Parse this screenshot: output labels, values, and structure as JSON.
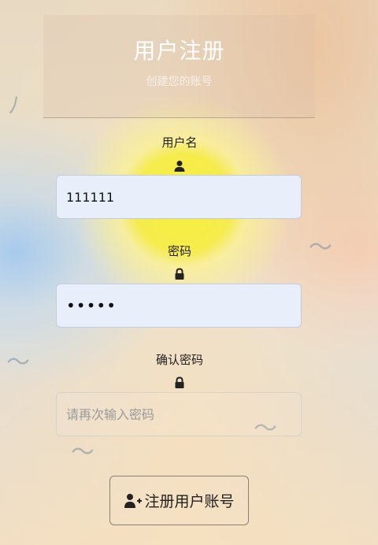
{
  "header": {
    "title": "用户注册",
    "subtitle": "创建您的账号"
  },
  "fields": {
    "username": {
      "label": "用户名",
      "icon": "user-icon",
      "value": "111111",
      "placeholder": ""
    },
    "password": {
      "label": "密码",
      "icon": "lock-icon",
      "value": "•••••",
      "placeholder": ""
    },
    "confirm_password": {
      "label": "确认密码",
      "icon": "lock-icon",
      "value": "",
      "placeholder": "请再次输入密码"
    }
  },
  "submit": {
    "label": "注册用户账号",
    "icon": "user-plus-icon"
  },
  "colors": {
    "input_filled_bg": "#e8effb",
    "title_text": "#ffffff",
    "label_text": "#222222"
  }
}
